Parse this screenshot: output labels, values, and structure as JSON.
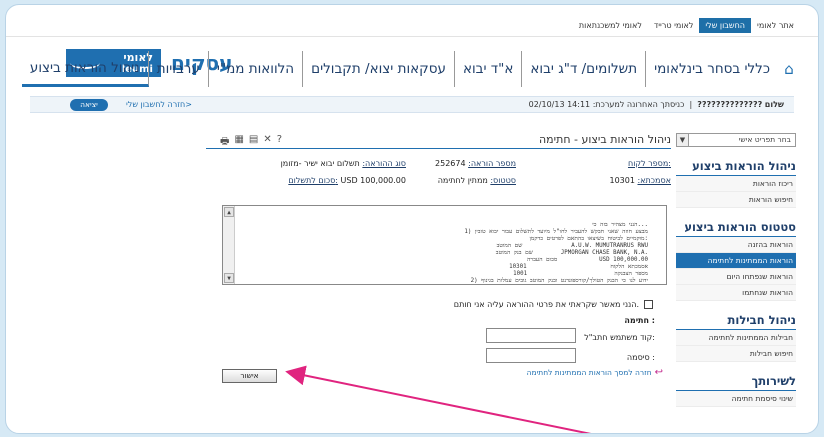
{
  "top_links": [
    {
      "label": "אתר לאומי",
      "active": false
    },
    {
      "label": "החשבון שלי",
      "active": true
    },
    {
      "label": "לאומי טרייד",
      "active": false
    },
    {
      "label": "לאומי למשכנתאות",
      "active": false
    }
  ],
  "brand": {
    "title": "עסקים",
    "logo_he": "לאומי",
    "logo_en": "leumi"
  },
  "main_nav": [
    {
      "label": "כללי בסחר בינלאומי"
    },
    {
      "label": "תשלומים/ ד\"ג יבוא"
    },
    {
      "label": "א\"ד יבוא"
    },
    {
      "label": "עסקאות יצוא/ תקבולים"
    },
    {
      "label": "הלוואות ממ\"י"
    },
    {
      "label": "ערבויות"
    },
    {
      "label": "ניהול הוראות ביצוע"
    }
  ],
  "greeting": {
    "label": "שלום",
    "name": "??????????????",
    "last_login": "כניסתך האחרונה למערכת: 14:11 02/10/13",
    "back_link": "חזרה לחשבון שלי>",
    "exit": "יציאה"
  },
  "sidebar": {
    "select": "בחר תפריט אישי",
    "sections": [
      {
        "title": "ניהול הוראות ביצוע",
        "items": [
          {
            "label": "ריכוז הוראות"
          },
          {
            "label": "חיפוש הוראות"
          }
        ]
      },
      {
        "title": "סטטוס הוראות ביצוע",
        "items": [
          {
            "label": "הוראות בהזנה"
          },
          {
            "label": "הוראות הממתינות לחתימה",
            "active": true
          },
          {
            "label": "הוראות שנפתחו היום"
          },
          {
            "label": "הוראות שנחתמו"
          }
        ]
      },
      {
        "title": "ניהול חבילות",
        "items": [
          {
            "label": "חבילות הממתינות לחתימה"
          },
          {
            "label": "חיפוש חבילות"
          }
        ]
      },
      {
        "title": "לשירותך",
        "items": [
          {
            "label": "שינוי סיסמת חתימה"
          }
        ]
      }
    ]
  },
  "content": {
    "title": "ניהול הוראות ביצוע - חתימה",
    "client_label": "מספר לקוח:",
    "client_value": "",
    "order_label": "מספר הוראה:",
    "order_value": "252674",
    "type_label": "סוג ההוראה:",
    "type_value": "תשלום יבוא ישיר -מזומן",
    "asm_label": "אסמכתא:",
    "asm_value": "10301",
    "status_label": "סטטוס:",
    "status_value": "ממתין לחתימה",
    "amount_label": "סכום לתשלום:",
    "amount_value": "USD 100,000.00",
    "message": "הנני מצהיר בזה כי...\n1) מבצע חוזה שאני חבקש להעביר לחו\"ל מיועד לתשלום עבור יבוא טובין\n   מוקמיים לביטוח בשיצאו בהתאם לפרטים כדקמן:\nשם המוטב              A.U.W. MUMUTRANRUS RWU\nשם בנק המוטב        JPMORGAN CHASE BANK, N.A.\nסכום העברה            USD 100,000.00\nאסמכתא הלקוח                        10301\nמספר הצבנקה                         1001\n2) ידוע לנו כי הבנק הטולך/קורספונדנט ובנק המוטב גובים עמלות בגינוף\n   לעמלות בנק לאומי.",
    "confirm_text": "הנני מאשר שקראתי את פרטי ההוראה עליה אני חותם.",
    "signature_title": "חתימה :",
    "user_code_label": "קוד משתמש חתב\"ל:",
    "password_label": "סיסמה :",
    "back_to_list": "חזרה למסך הוראות הממתינות לחתימה",
    "ok_button": "אישור"
  },
  "colors": {
    "accent": "#1f6fb0",
    "arrow": "#e0247f"
  }
}
